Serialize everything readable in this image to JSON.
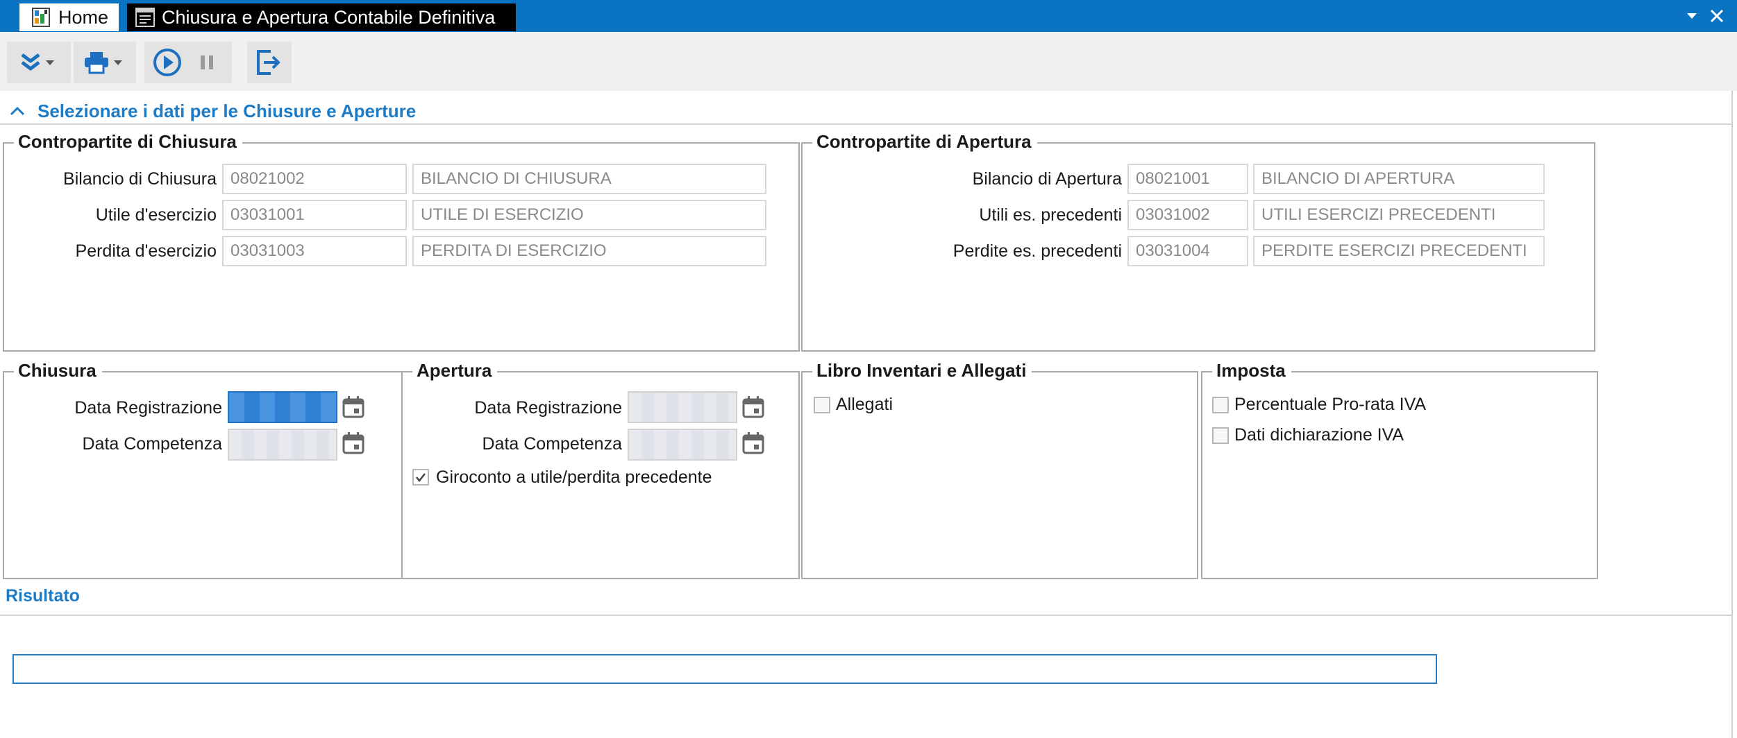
{
  "window": {
    "tabs": [
      {
        "label": "Home",
        "icon": "home-app-icon"
      },
      {
        "label": "Chiusura e Apertura Contabile Definitiva",
        "icon": "form-icon"
      }
    ],
    "controls": [
      "dropdown-icon",
      "close-icon"
    ],
    "accent_color": "#0a74c2"
  },
  "toolbar": {
    "buttons": [
      "expand-icon",
      "print-icon",
      "play-icon",
      "pause-icon",
      "exit-icon"
    ]
  },
  "section": {
    "title": "Selezionare i dati per le Chiusure e Aperture",
    "color": "#1e7bc6"
  },
  "chiusura_contropartite": {
    "title": "Contropartite di Chiusura",
    "rows": [
      {
        "label": "Bilancio di Chiusura",
        "code": "08021002",
        "description": "BILANCIO DI CHIUSURA"
      },
      {
        "label": "Utile d'esercizio",
        "code": "03031001",
        "description": "UTILE DI ESERCIZIO"
      },
      {
        "label": "Perdita d'esercizio",
        "code": "03031003",
        "description": "PERDITA DI ESERCIZIO"
      }
    ]
  },
  "apertura_contropartite": {
    "title": "Contropartite di Apertura",
    "rows": [
      {
        "label": "Bilancio di Apertura",
        "code": "08021001",
        "description": "BILANCIO DI APERTURA"
      },
      {
        "label": "Utili es. precedenti",
        "code": "03031002",
        "description": "UTILI ESERCIZI PRECEDENTI"
      },
      {
        "label": "Perdite es. precedenti",
        "code": "03031004",
        "description": "PERDITE ESERCIZI PRECEDENTI"
      }
    ]
  },
  "chiusura": {
    "title": "Chiusura",
    "data_registrazione_label": "Data Registrazione",
    "data_competenza_label": "Data Competenza"
  },
  "apertura": {
    "title": "Apertura",
    "data_registrazione_label": "Data Registrazione",
    "data_competenza_label": "Data Competenza",
    "giroconto_label": "Giroconto a utile/perdita precedente",
    "giroconto_checked": true
  },
  "libro": {
    "title": "Libro Inventari e Allegati",
    "allegati_label": "Allegati",
    "allegati_checked": false
  },
  "imposta": {
    "title": "Imposta",
    "prorata_label": "Percentuale Pro-rata IVA",
    "prorata_checked": false,
    "dichiarazione_label": "Dati dichiarazione IVA",
    "dichiarazione_checked": false
  },
  "risultato": {
    "title": "Risultato",
    "progress": 0
  }
}
